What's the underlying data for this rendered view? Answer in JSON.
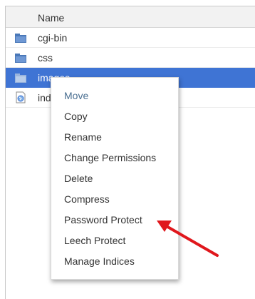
{
  "table": {
    "column_header": "Name",
    "rows": [
      {
        "name": "cgi-bin",
        "icon": "folder-icon",
        "selected": false
      },
      {
        "name": "css",
        "icon": "folder-icon",
        "selected": false
      },
      {
        "name": "images",
        "icon": "folder-icon",
        "selected": true
      },
      {
        "name": "ind",
        "icon": "html-file-icon",
        "selected": false
      }
    ]
  },
  "context_menu": {
    "items": [
      "Move",
      "Copy",
      "Rename",
      "Change Permissions",
      "Delete",
      "Compress",
      "Password Protect",
      "Leech Protect",
      "Manage Indices"
    ]
  },
  "colors": {
    "selection": "#3f74d4",
    "folder": "#4a78b8",
    "arrow": "#e0171c"
  }
}
